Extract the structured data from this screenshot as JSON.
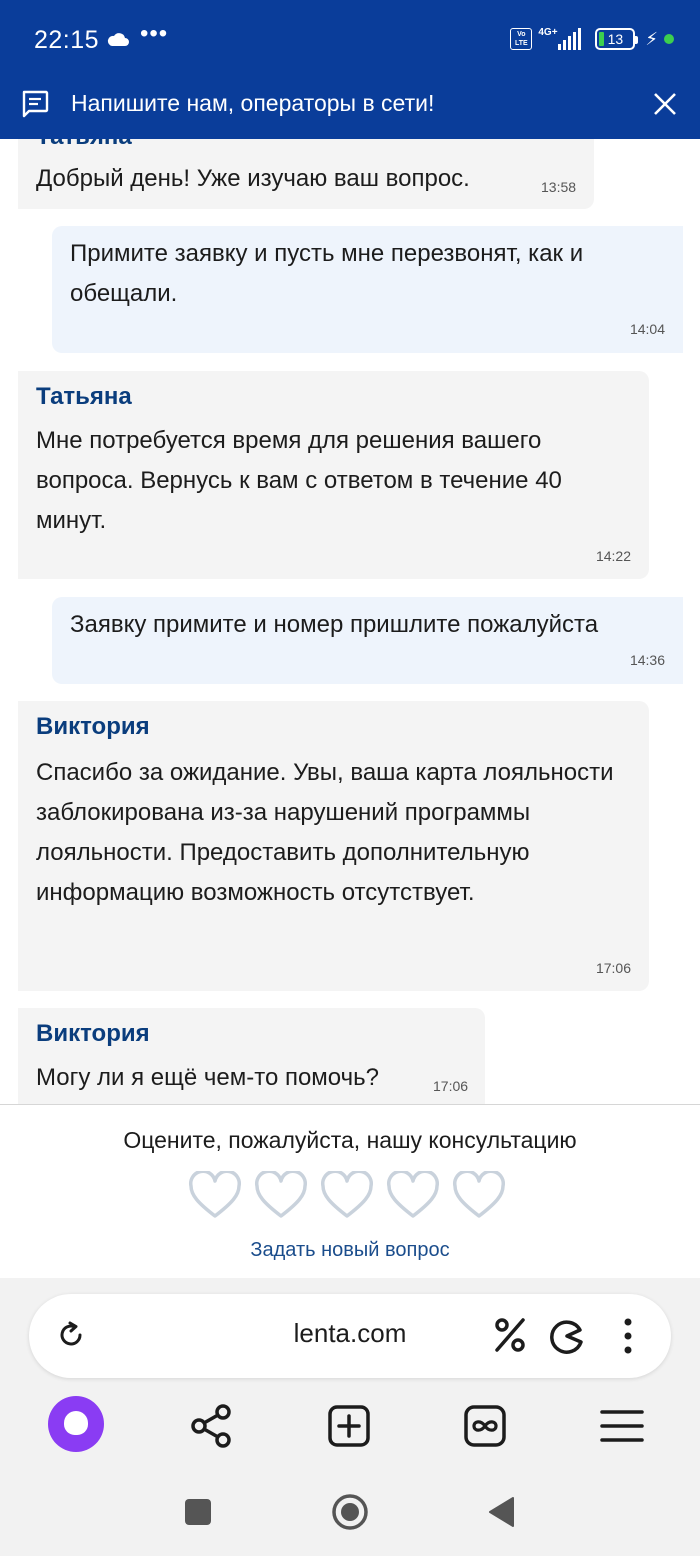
{
  "status_bar": {
    "time": "22:15",
    "network": "4G+",
    "volte": "Vo LTE",
    "battery": "13",
    "icons": [
      "cloud-icon",
      "more-dots-icon",
      "volte-icon",
      "signal-icon",
      "battery-icon",
      "charging-icon",
      "green-dot-icon"
    ]
  },
  "chat_header": {
    "title": "Напишите нам, операторы в сети!",
    "icons": [
      "chat-icon",
      "close-icon"
    ]
  },
  "messages": [
    {
      "from": "operator",
      "author": "Татьяна",
      "text": "Добрый день! Уже изучаю ваш вопрос.",
      "time": "13:58"
    },
    {
      "from": "user",
      "text": "Примите заявку и пусть мне перезвонят, как и обещали.",
      "time": "14:04"
    },
    {
      "from": "operator",
      "author": "Татьяна",
      "text": "Мне потребуется время для решения вашего вопроса. Вернусь к вам с ответом в течение 40 минут.",
      "time": "14:22"
    },
    {
      "from": "user",
      "text": "Заявку примите и номер пришлите пожалуйста",
      "time": "14:36"
    },
    {
      "from": "operator",
      "author": "Виктория",
      "text": "Спасибо за ожидание. Увы, ваша карта лояльности заблокирована из-за нарушений программы лояльности. Предоставить дополнительную информацию возможность отсутствует.",
      "time": "17:06"
    },
    {
      "from": "operator",
      "author": "Виктория",
      "text": "Могу ли я ещё чем-то помочь?",
      "time": "17:06"
    }
  ],
  "rating": {
    "prompt": "Оцените, пожалуйста, нашу консультацию",
    "max_hearts": 5,
    "selected": 0,
    "new_question_label": "Задать новый вопрос"
  },
  "browser": {
    "url": "lenta.com",
    "icons": [
      "reload-icon",
      "percent-icon",
      "pacman-icon",
      "more-vertical-icon"
    ]
  },
  "bottom_nav": {
    "icons": [
      "alice-icon",
      "share-icon",
      "new-tab-icon",
      "tabs-icon",
      "menu-icon"
    ]
  },
  "system_nav": {
    "icons": [
      "recents-icon",
      "home-icon",
      "back-icon"
    ]
  },
  "colors": {
    "header_bg": "#0a3d9a",
    "operator_bubble": "#f4f4f4",
    "user_bubble": "#eef4fc",
    "author_name": "#0a3d7d",
    "link": "#1b4d8c",
    "heart_outline": "#c9d2dc",
    "alice": "#8a3cf3"
  }
}
